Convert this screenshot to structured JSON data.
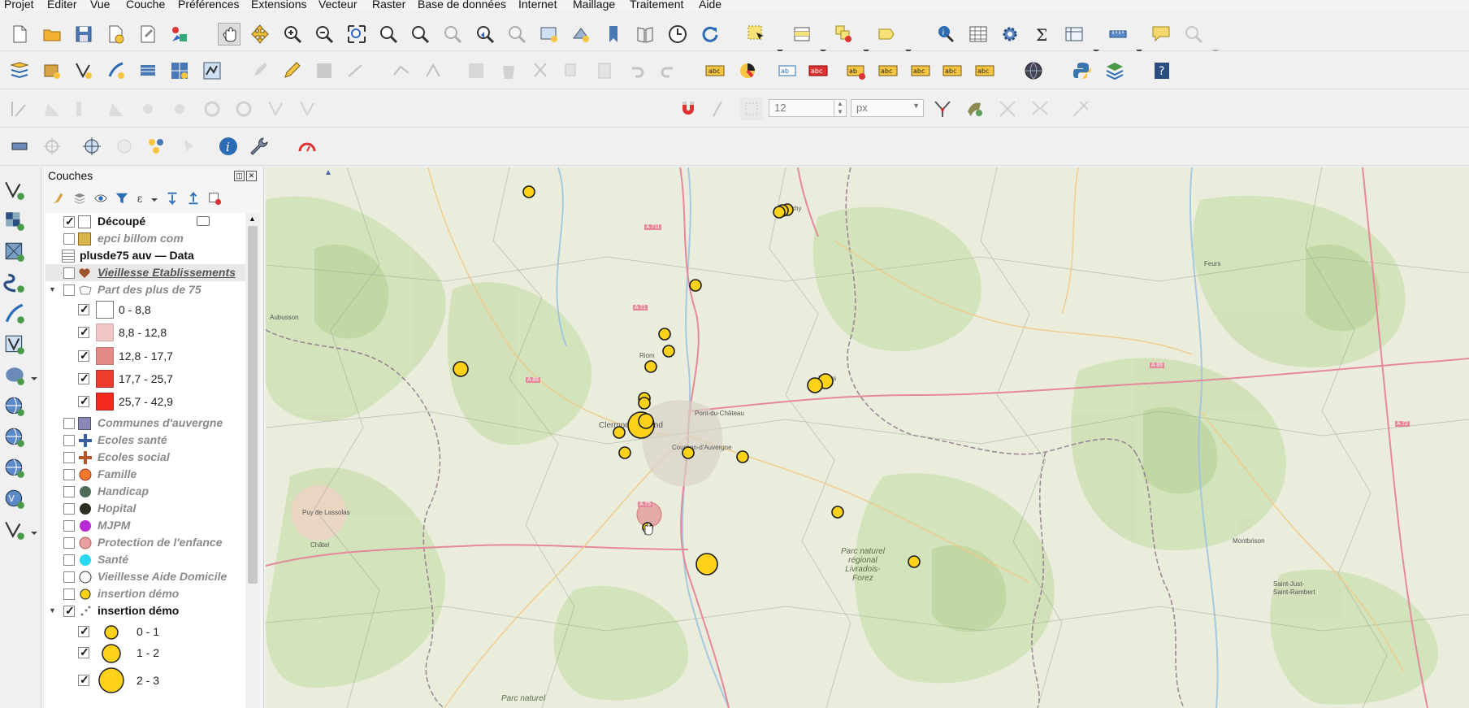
{
  "menu": [
    "Projet",
    "Editer",
    "Vue",
    "Couche",
    "Préférences",
    "Extensions",
    "Vecteur",
    "Raster",
    "Base de données",
    "Internet",
    "Maillage",
    "Traitement",
    "Aide"
  ],
  "snapping": {
    "tolerance_value": "12",
    "unit": "px"
  },
  "panel": {
    "title": "Couches",
    "layers": [
      {
        "label": "Découpé",
        "style": "b"
      },
      {
        "label": "epci billom com",
        "style": "it"
      },
      {
        "label": "plusde75 auv — Data",
        "style": "b"
      },
      {
        "label": "Vieillesse Etablissements",
        "style": "it"
      },
      {
        "label": "Part des plus de 75",
        "style": "it"
      },
      {
        "label": "0 - 8,8",
        "style": "sym"
      },
      {
        "label": "8,8 - 12,8",
        "style": "sym"
      },
      {
        "label": "12,8 - 17,7",
        "style": "sym"
      },
      {
        "label": "17,7 - 25,7",
        "style": "sym"
      },
      {
        "label": "25,7 - 42,9",
        "style": "sym"
      },
      {
        "label": "Communes d'auvergne",
        "style": "it"
      },
      {
        "label": "Ecoles santé",
        "style": "it"
      },
      {
        "label": "Ecoles social",
        "style": "it"
      },
      {
        "label": "Famille",
        "style": "it"
      },
      {
        "label": "Handicap",
        "style": "it"
      },
      {
        "label": "Hopital",
        "style": "it"
      },
      {
        "label": "MJPM",
        "style": "it"
      },
      {
        "label": "Protection de l'enfance",
        "style": "it"
      },
      {
        "label": "Santé",
        "style": "it"
      },
      {
        "label": "Vieillesse Aide Domicile",
        "style": "it"
      },
      {
        "label": "insertion démo",
        "style": "it"
      },
      {
        "label": "insertion démo",
        "style": "b"
      },
      {
        "label": "0 - 1",
        "style": "sym"
      },
      {
        "label": "1 - 2",
        "style": "sym"
      },
      {
        "label": "2 - 3",
        "style": "sym"
      }
    ]
  },
  "map_labels": {
    "a711": "A 711",
    "a71": "A 71",
    "a89": "A 89",
    "a75": "A 75",
    "a72": "A 72",
    "a89b": "A 89",
    "clermont": "Clermont-Ferrand",
    "riom": "Riom",
    "pont": "Pont-du-Château",
    "cournon": "Cournon-d'Auvergne",
    "livradois1": "Parc naturel",
    "livradois2": "régional",
    "livradois3": "Livradois-",
    "livradois4": "Forez",
    "volcans": "Parc naturel",
    "thiers": "Thiers",
    "vichy": "Vichy",
    "aubusson": "Aubusson",
    "feurs": "Feurs",
    "montbrison": "Montbrison",
    "stjust": "Saint-Just-",
    "stjust2": "Saint-Rambert",
    "pontgibaud": "Puy de Lassolas",
    "chatel": "Châtel"
  },
  "colors": {
    "point_fill": "#FFD21A",
    "point_stroke": "#1a1a1a",
    "pink": "#d9838b"
  }
}
